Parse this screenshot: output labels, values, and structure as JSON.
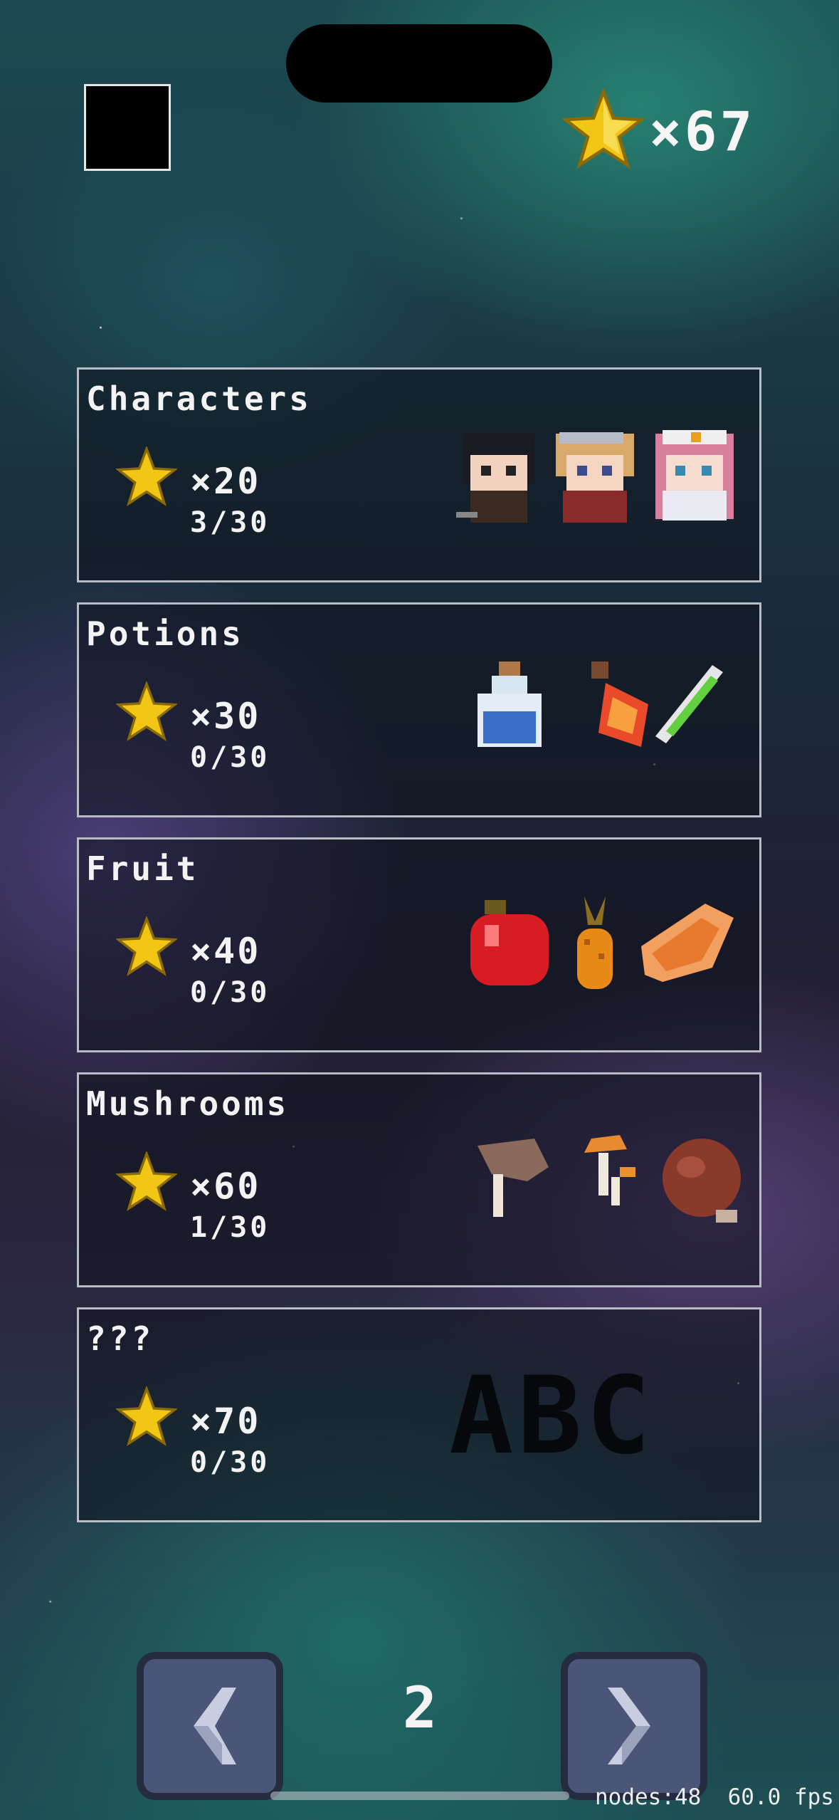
{
  "header": {
    "star_count": "×67"
  },
  "cards": [
    {
      "title": "Characters",
      "multiplier": "×20",
      "progress": "3/30",
      "art": "character-sprites"
    },
    {
      "title": "Potions",
      "multiplier": "×30",
      "progress": "0/30",
      "art": "potion-sprites"
    },
    {
      "title": "Fruit",
      "multiplier": "×40",
      "progress": "0/30",
      "art": "fruit-sprites"
    },
    {
      "title": "Mushrooms",
      "multiplier": "×60",
      "progress": "1/30",
      "art": "mushroom-sprites"
    },
    {
      "title": "???",
      "multiplier": "×70",
      "progress": "0/30",
      "art": "locked-letters",
      "locked_text": "ABC"
    }
  ],
  "pager": {
    "page": "2",
    "prev_icon": "chevron-left-icon",
    "next_icon": "chevron-right-icon"
  },
  "debug": {
    "nodes": "nodes:48",
    "fps": "60.0 fps"
  },
  "colors": {
    "star": "#f2c614",
    "card_border": "#b8bcc4",
    "button": "#4a5578"
  }
}
